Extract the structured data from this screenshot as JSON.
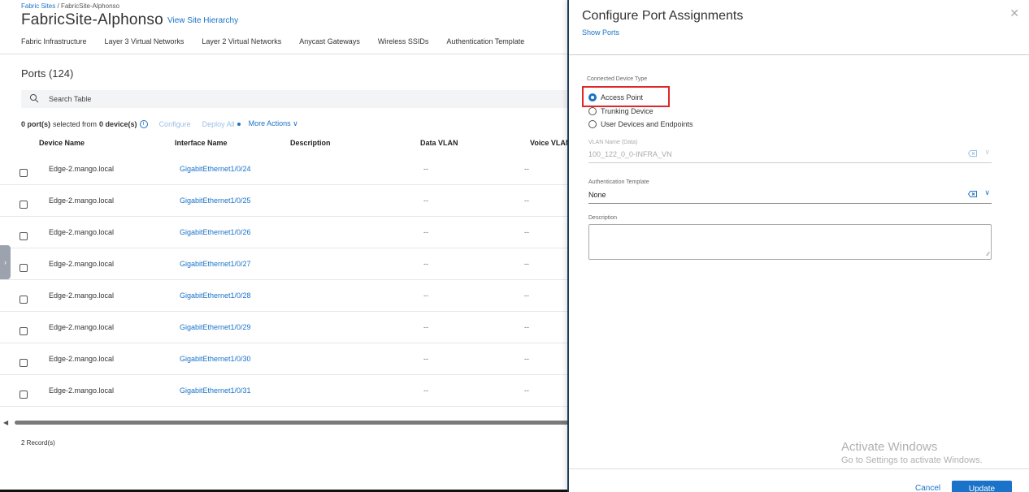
{
  "breadcrumb": {
    "parent": "Fabric Sites",
    "separator": "/",
    "current": "FabricSite-Alphonso"
  },
  "site": {
    "title": "FabricSite-Alphonso",
    "hierarchy_link": "View Site Hierarchy"
  },
  "tabs": [
    "Fabric Infrastructure",
    "Layer 3 Virtual Networks",
    "Layer 2 Virtual Networks",
    "Anycast Gateways",
    "Wireless SSIDs",
    "Authentication Template"
  ],
  "ports": {
    "title": "Ports (124)",
    "search_placeholder": "Search Table",
    "selection": {
      "count": "0 port(s)",
      "middle": "selected from",
      "devices": "0 device(s)"
    },
    "actions": {
      "configure": "Configure",
      "deploy_all": "Deploy All",
      "more_actions": "More Actions"
    },
    "columns": {
      "device": "Device Name",
      "interface": "Interface Name",
      "description": "Description",
      "data_vlan": "Data VLAN",
      "voice_vlan": "Voice VLAN"
    },
    "rows": [
      {
        "device": "Edge-2.mango.local",
        "interface": "GigabitEthernet1/0/24",
        "data_vlan": "--",
        "voice_vlan": "--"
      },
      {
        "device": "Edge-2.mango.local",
        "interface": "GigabitEthernet1/0/25",
        "data_vlan": "--",
        "voice_vlan": "--"
      },
      {
        "device": "Edge-2.mango.local",
        "interface": "GigabitEthernet1/0/26",
        "data_vlan": "--",
        "voice_vlan": "--"
      },
      {
        "device": "Edge-2.mango.local",
        "interface": "GigabitEthernet1/0/27",
        "data_vlan": "--",
        "voice_vlan": "--"
      },
      {
        "device": "Edge-2.mango.local",
        "interface": "GigabitEthernet1/0/28",
        "data_vlan": "--",
        "voice_vlan": "--"
      },
      {
        "device": "Edge-2.mango.local",
        "interface": "GigabitEthernet1/0/29",
        "data_vlan": "--",
        "voice_vlan": "--"
      },
      {
        "device": "Edge-2.mango.local",
        "interface": "GigabitEthernet1/0/30",
        "data_vlan": "--",
        "voice_vlan": "--"
      },
      {
        "device": "Edge-2.mango.local",
        "interface": "GigabitEthernet1/0/31",
        "data_vlan": "--",
        "voice_vlan": "--"
      }
    ],
    "records": "2 Record(s)"
  },
  "drawer": {
    "title": "Configure Port Assignments",
    "show_ports": "Show Ports",
    "connected_label": "Connected Device Type",
    "options": [
      "Access Point",
      "Trunking Device",
      "User Devices and Endpoints"
    ],
    "selected_option": "Access Point",
    "vlan_label": "VLAN Name (Data)",
    "vlan_value": "100_122_0_0-INFRA_VN",
    "auth_label": "Authentication Template",
    "auth_value": "None",
    "description_label": "Description",
    "description_value": "",
    "cancel": "Cancel",
    "update": "Update"
  },
  "watermark": {
    "line1": "Activate Windows",
    "line2": "Go to Settings to activate Windows."
  },
  "colors": {
    "accent": "#1a73c8",
    "highlight": "#e0262a"
  }
}
